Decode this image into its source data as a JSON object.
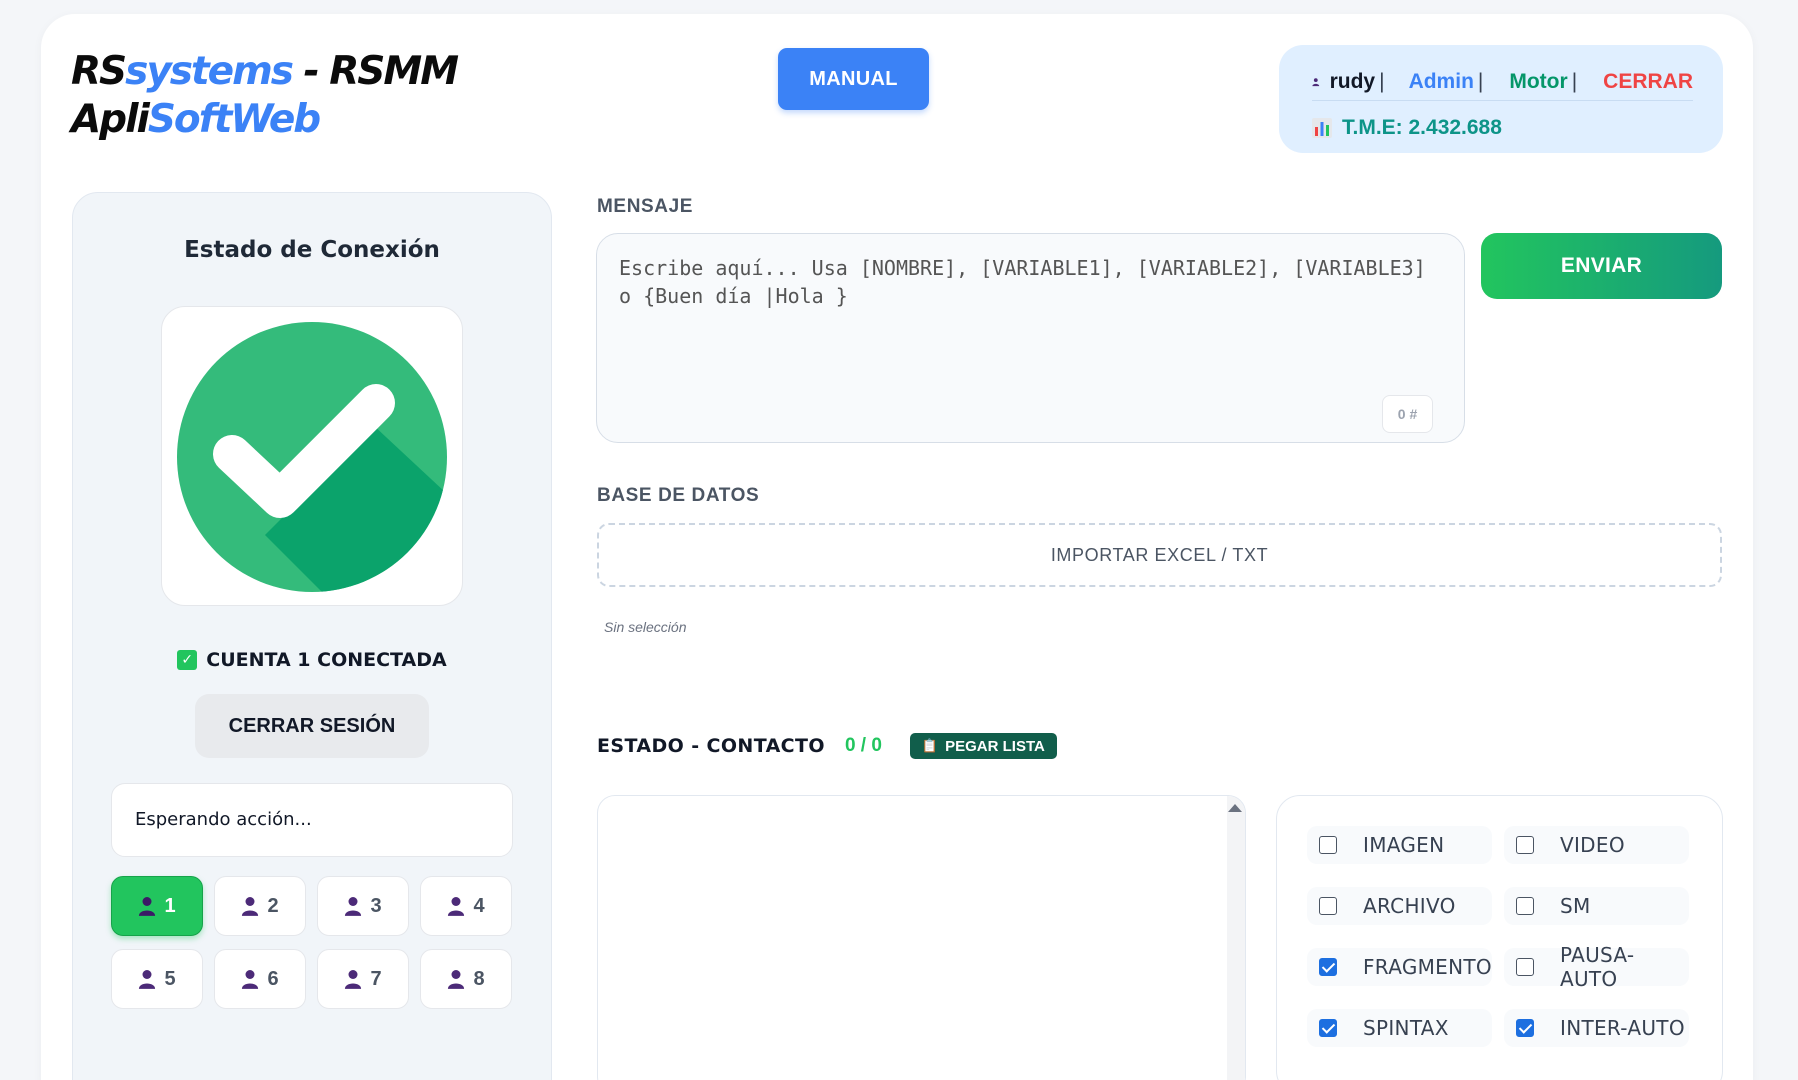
{
  "logo": {
    "line1_a": "RS",
    "line1_b": "systems",
    "line1_c": " - RSMM",
    "line2_a": "Apli",
    "line2_b": "SoftWeb"
  },
  "header": {
    "manual_label": "MANUAL"
  },
  "user": {
    "name": "rudy",
    "role": "Admin",
    "motor": "Motor",
    "close": "CERRAR",
    "separator": "|",
    "tme": "T.M.E: 2.432.688"
  },
  "connection": {
    "title": "Estado de Conexión",
    "account_status": "CUENTA 1 CONECTADA",
    "logout_label": "CERRAR SESIÓN",
    "waiting": "Esperando acción..."
  },
  "accounts": [
    {
      "label": "1",
      "active": true
    },
    {
      "label": "2",
      "active": false
    },
    {
      "label": "3",
      "active": false
    },
    {
      "label": "4",
      "active": false
    },
    {
      "label": "5",
      "active": false
    },
    {
      "label": "6",
      "active": false
    },
    {
      "label": "7",
      "active": false
    },
    {
      "label": "8",
      "active": false
    }
  ],
  "message": {
    "label": "MENSAJE",
    "placeholder": "Escribe aquí... Usa [NOMBRE], [VARIABLE1], [VARIABLE2], [VARIABLE3] o {Buen día |Hola }",
    "counter": "0 #",
    "send_label": "ENVIAR"
  },
  "database": {
    "label": "BASE DE DATOS",
    "import_label": "IMPORTAR EXCEL / TXT",
    "no_selection": "Sin selección"
  },
  "contacts": {
    "label": "ESTADO - CONTACTO",
    "count": "0 / 0",
    "paste_label": "PEGAR LISTA"
  },
  "options": [
    {
      "label": "IMAGEN",
      "checked": false
    },
    {
      "label": "VIDEO",
      "checked": false
    },
    {
      "label": "ARCHIVO",
      "checked": false
    },
    {
      "label": "SM",
      "checked": false
    },
    {
      "label": "FRAGMENTO",
      "checked": true
    },
    {
      "label": "PAUSA-AUTO",
      "checked": false
    },
    {
      "label": "SPINTAX",
      "checked": true
    },
    {
      "label": "INTER-AUTO",
      "checked": true
    }
  ],
  "colors": {
    "accent": "#3b82f6",
    "success": "#22c55e",
    "danger": "#ef4444"
  }
}
